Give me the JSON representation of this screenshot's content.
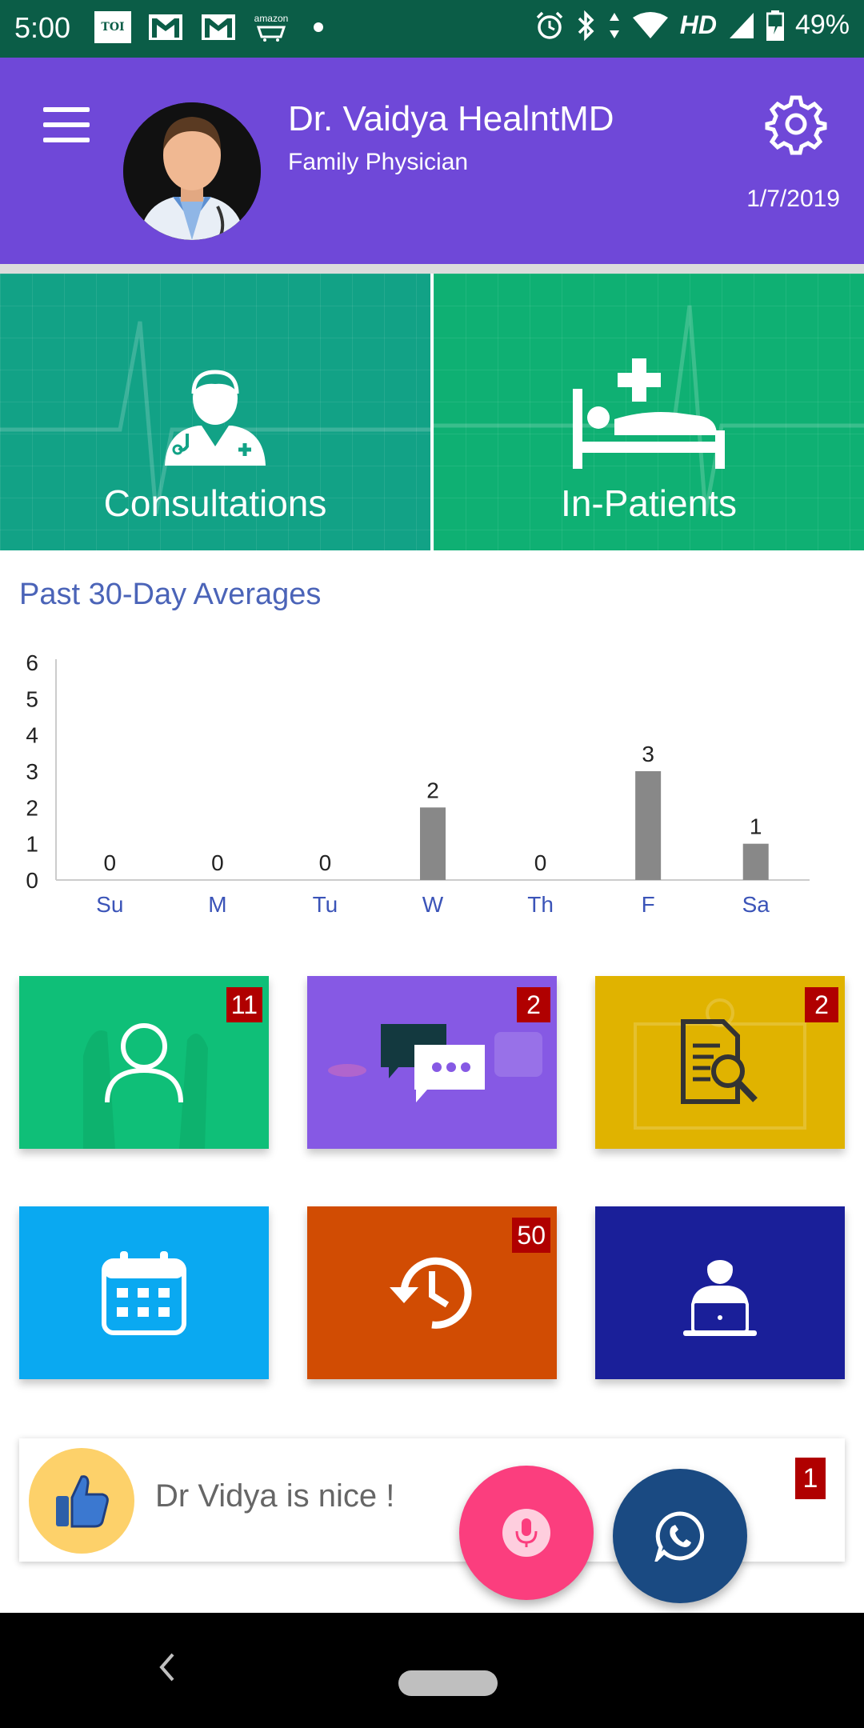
{
  "status_bar": {
    "time": "5:00",
    "toi_label": "TOI",
    "amazon_label": "amazon",
    "network_label": "HD",
    "battery": "49%"
  },
  "header": {
    "doctor_name": "Dr. Vaidya HealntMD",
    "doctor_title": "Family Physician",
    "date": "1/7/2019",
    "background_color": "#6f48d8"
  },
  "tiles_top": [
    {
      "label": "Consultations",
      "color": "#12a286",
      "icon": "doctor-icon"
    },
    {
      "label": "In-Patients",
      "color": "#0fb073",
      "icon": "hospital-bed-icon"
    }
  ],
  "chart_data": {
    "type": "bar",
    "title": "Past 30-Day Averages",
    "categories": [
      "Su",
      "M",
      "Tu",
      "W",
      "Th",
      "F",
      "Sa"
    ],
    "values": [
      0,
      0,
      0,
      2,
      0,
      3,
      1
    ],
    "yticks": [
      "0",
      "1",
      "2",
      "3",
      "4",
      "5",
      "6"
    ],
    "ylim": [
      0,
      6
    ],
    "bar_color": "#888888",
    "label_color": "#3b54b8"
  },
  "tiles_small": [
    {
      "name": "patients",
      "badge": "11",
      "color": "#0fbf78",
      "icon": "person-icon"
    },
    {
      "name": "messages",
      "badge": "2",
      "color": "#8659e4",
      "icon": "chat-icon"
    },
    {
      "name": "reports",
      "badge": "2",
      "color": "#e0b300",
      "icon": "document-search-icon"
    },
    {
      "name": "calendar",
      "badge": "",
      "color": "#0aa9f1",
      "icon": "calendar-icon"
    },
    {
      "name": "history",
      "badge": "50",
      "color": "#d14c03",
      "icon": "history-icon"
    },
    {
      "name": "telemedicine",
      "badge": "",
      "color": "#1a1f99",
      "icon": "doctor-laptop-icon"
    }
  ],
  "feedback": {
    "text": "Dr Vidya is nice !",
    "badge": "1",
    "icon": "thumbs-up-icon"
  },
  "fabs": {
    "mic_icon": "microphone-icon",
    "whatsapp_icon": "whatsapp-icon"
  }
}
